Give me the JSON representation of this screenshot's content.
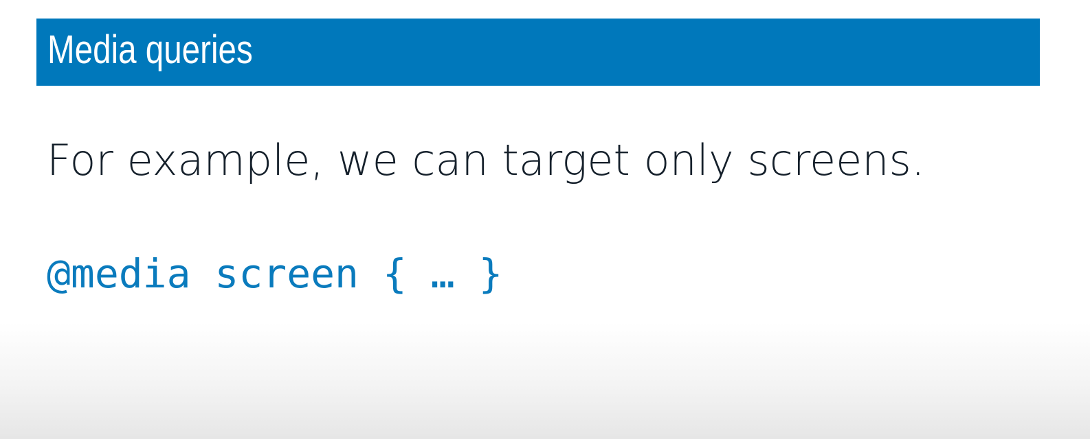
{
  "slide": {
    "title": "Media queries",
    "body_text": "For example, we can target only screens.",
    "code": "@media screen { … }"
  },
  "colors": {
    "title_bar": "#0078bb",
    "title_text": "#ffffff",
    "body_text": "#15202b",
    "code_text": "#0a7bbd",
    "background": "#ffffff"
  }
}
